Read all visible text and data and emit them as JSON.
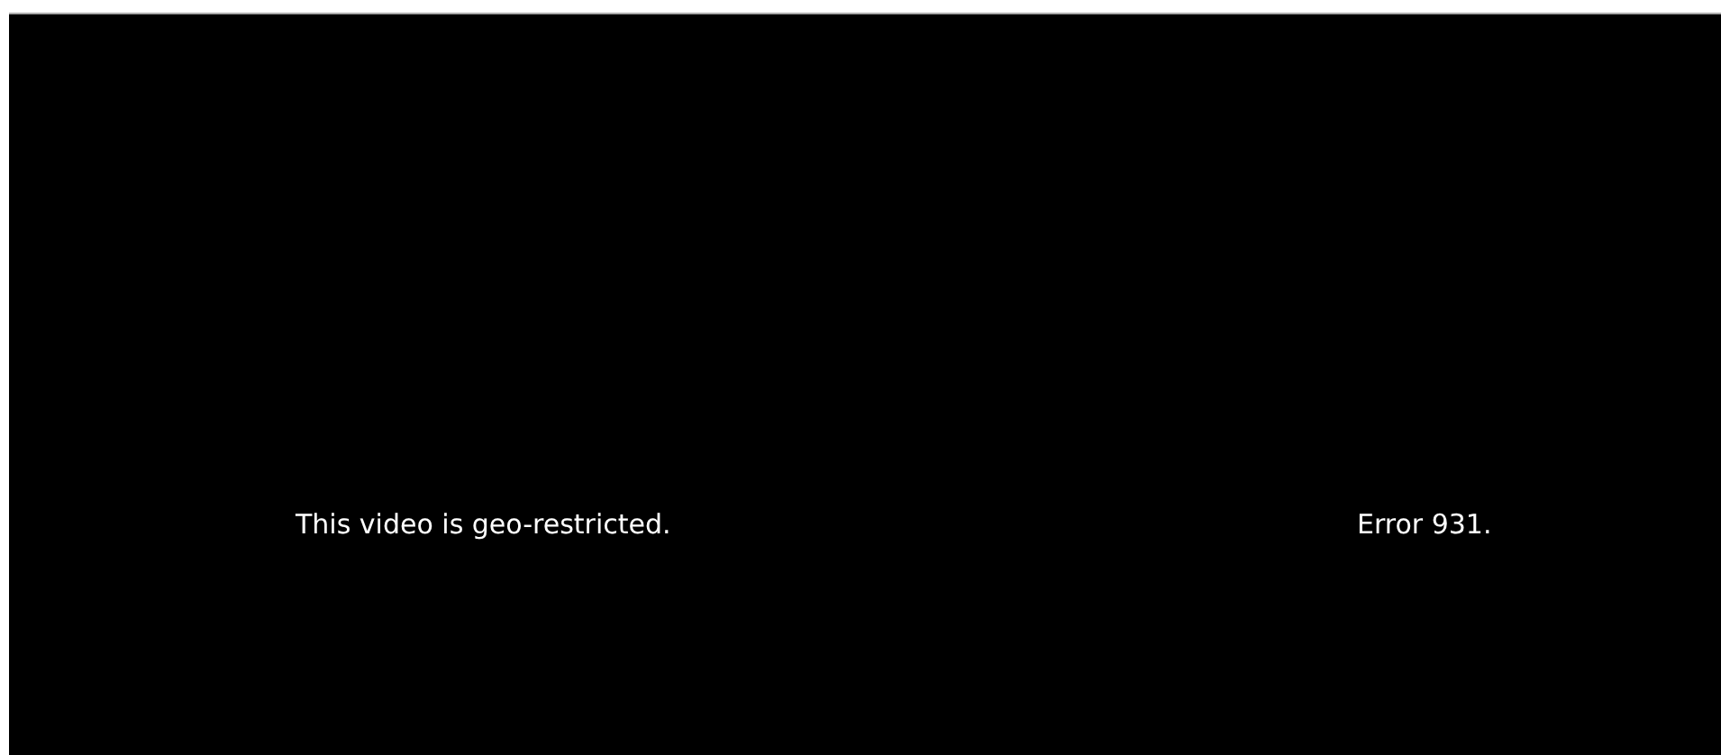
{
  "player": {
    "message": "This video is geo-restricted.",
    "error": "Error 931."
  }
}
